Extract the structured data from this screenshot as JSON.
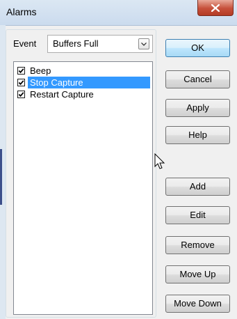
{
  "window": {
    "title": "Alarms",
    "close_glyph": "x"
  },
  "event": {
    "label": "Event",
    "selected": "Buffers Full"
  },
  "list": {
    "items": [
      {
        "label": "Beep",
        "checked": true,
        "selected": false
      },
      {
        "label": "Stop Capture",
        "checked": true,
        "selected": true
      },
      {
        "label": "Restart Capture",
        "checked": true,
        "selected": false
      }
    ]
  },
  "buttons": {
    "ok": "OK",
    "cancel": "Cancel",
    "apply": "Apply",
    "help": "Help",
    "add": "Add",
    "edit": "Edit",
    "remove": "Remove",
    "move_up": "Move Up",
    "move_down": "Move Down"
  },
  "colors": {
    "selection": "#3399ff",
    "close_button": "#c6503a",
    "default_button": "#bee6fd"
  },
  "icons": [
    "close-icon",
    "chevron-down-icon",
    "checkmark-icon",
    "mouse-pointer-icon"
  ]
}
